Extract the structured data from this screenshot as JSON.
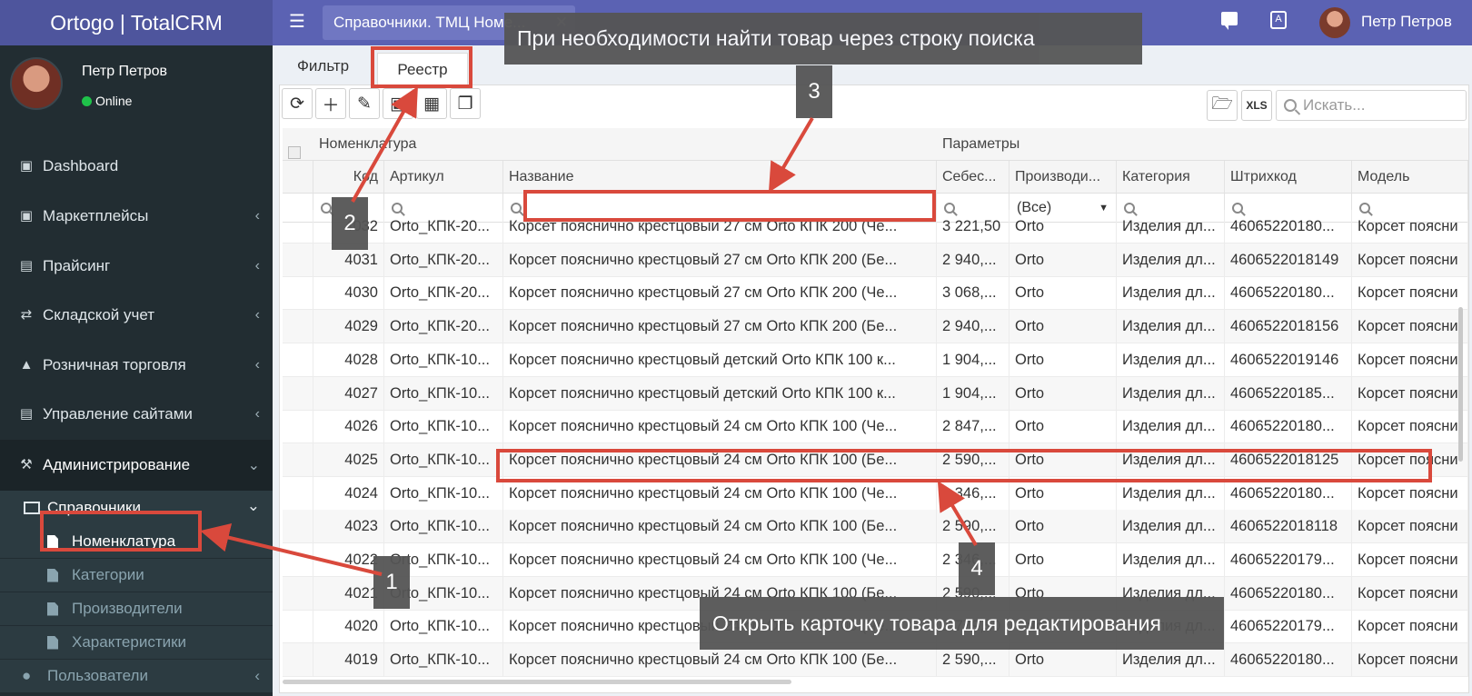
{
  "app": {
    "brand": "Ortogo | TotalCRM",
    "page_tab": "Справочники. ТМЦ Номе...",
    "user_name": "Петр Петров"
  },
  "sidebar": {
    "user_name": "Петр Петров",
    "status": "Online",
    "menu": [
      {
        "label": "Dashboard",
        "icon": "monitor-icon"
      },
      {
        "label": "Маркетплейсы",
        "icon": "briefcase-icon"
      },
      {
        "label": "Прайсинг",
        "icon": "credit-card-icon"
      },
      {
        "label": "Складской учет",
        "icon": "exchange-icon"
      },
      {
        "label": "Розничная торговля",
        "icon": "bank-icon"
      },
      {
        "label": "Управление сайтами",
        "icon": "newspaper-icon"
      },
      {
        "label": "Администрирование",
        "icon": "wrench-icon"
      }
    ],
    "sub_refs": "Справочники",
    "sub_items": [
      "Номенклатура",
      "Категории",
      "Производители",
      "Характеристики"
    ],
    "users": "Пользователи"
  },
  "tabs": {
    "filter": "Фильтр",
    "registry": "Реестр"
  },
  "search": {
    "placeholder": "Искать..."
  },
  "grid": {
    "band_nomenclature": "Номенклатура",
    "band_params": "Параметры",
    "columns": [
      "Код",
      "Артикул",
      "Название",
      "Себес...",
      "Производи...",
      "Категория",
      "Штрихкод",
      "Модель"
    ],
    "filter_select": "(Все)",
    "rows": [
      [
        "4032",
        "Orto_КПК-20...",
        "Корсет пояснично крестцовый 27 см Orto КПК 200 (Че...",
        "3 221,50",
        "Orto",
        "Изделия дл...",
        "46065220180...",
        "Корсет поясни"
      ],
      [
        "4031",
        "Orto_КПК-20...",
        "Корсет пояснично крестцовый 27 см Orto КПК 200 (Бе...",
        "2 940,...",
        "Orto",
        "Изделия дл...",
        "4606522018149",
        "Корсет поясни"
      ],
      [
        "4030",
        "Orto_КПК-20...",
        "Корсет пояснично крестцовый 27 см Orto КПК 200 (Че...",
        "3 068,...",
        "Orto",
        "Изделия дл...",
        "46065220180...",
        "Корсет поясни"
      ],
      [
        "4029",
        "Orto_КПК-20...",
        "Корсет пояснично крестцовый 27 см Orto КПК 200 (Бе...",
        "2 940,...",
        "Orto",
        "Изделия дл...",
        "4606522018156",
        "Корсет поясни"
      ],
      [
        "4028",
        "Orto_КПК-10...",
        "Корсет пояснично крестцовый детский Orto КПК 100 к...",
        "1 904,...",
        "Orto",
        "Изделия дл...",
        "4606522019146",
        "Корсет поясни"
      ],
      [
        "4027",
        "Orto_КПК-10...",
        "Корсет пояснично крестцовый детский Orto КПК 100 к...",
        "1 904,...",
        "Orto",
        "Изделия дл...",
        "46065220185...",
        "Корсет поясни"
      ],
      [
        "4026",
        "Orto_КПК-10...",
        "Корсет пояснично крестцовый 24 см Orto КПК 100 (Че...",
        "2 847,...",
        "Orto",
        "Изделия дл...",
        "46065220180...",
        "Корсет поясни"
      ],
      [
        "4025",
        "Orto_КПК-10...",
        "Корсет пояснично крестцовый 24 см Orto КПК 100 (Бе...",
        "2 590,...",
        "Orto",
        "Изделия дл...",
        "4606522018125",
        "Корсет поясни"
      ],
      [
        "4024",
        "Orto_КПК-10...",
        "Корсет пояснично крестцовый 24 см Orto КПК 100 (Че...",
        "2 346,...",
        "Orto",
        "Изделия дл...",
        "46065220180...",
        "Корсет поясни"
      ],
      [
        "4023",
        "Orto_КПК-10...",
        "Корсет пояснично крестцовый 24 см Orto КПК 100 (Бе...",
        "2 590,...",
        "Orto",
        "Изделия дл...",
        "4606522018118",
        "Корсет поясни"
      ],
      [
        "4022",
        "Orto_КПК-10...",
        "Корсет пояснично крестцовый 24 см Orto КПК 100 (Че...",
        "2 346,...",
        "Orto",
        "Изделия дл...",
        "46065220179...",
        "Корсет поясни"
      ],
      [
        "4021",
        "Orto_КПК-10...",
        "Корсет пояснично крестцовый 24 см Orto КПК 100 (Бе...",
        "2 590,...",
        "Orto",
        "Изделия дл...",
        "46065220180...",
        "Корсет поясни"
      ],
      [
        "4020",
        "Orto_КПК-10...",
        "Корсет пояснично крестцовый 24 см Orto КПК 100 (Че...",
        "2 779,50",
        "Orto",
        "Изделия дл...",
        "46065220179...",
        "Корсет поясни"
      ],
      [
        "4019",
        "Orto_КПК-10...",
        "Корсет пояснично крестцовый 24 см Orto КПК 100 (Бе...",
        "2 590,...",
        "Orto",
        "Изделия дл...",
        "46065220180...",
        "Корсет поясни"
      ]
    ]
  },
  "annotations": {
    "search_hint": "При необходимости найти товар через строку поиска",
    "open_card_hint": "Открыть карточку товара для редактирования",
    "badges": [
      "1",
      "2",
      "3",
      "4"
    ],
    "color": "#d9493c"
  }
}
